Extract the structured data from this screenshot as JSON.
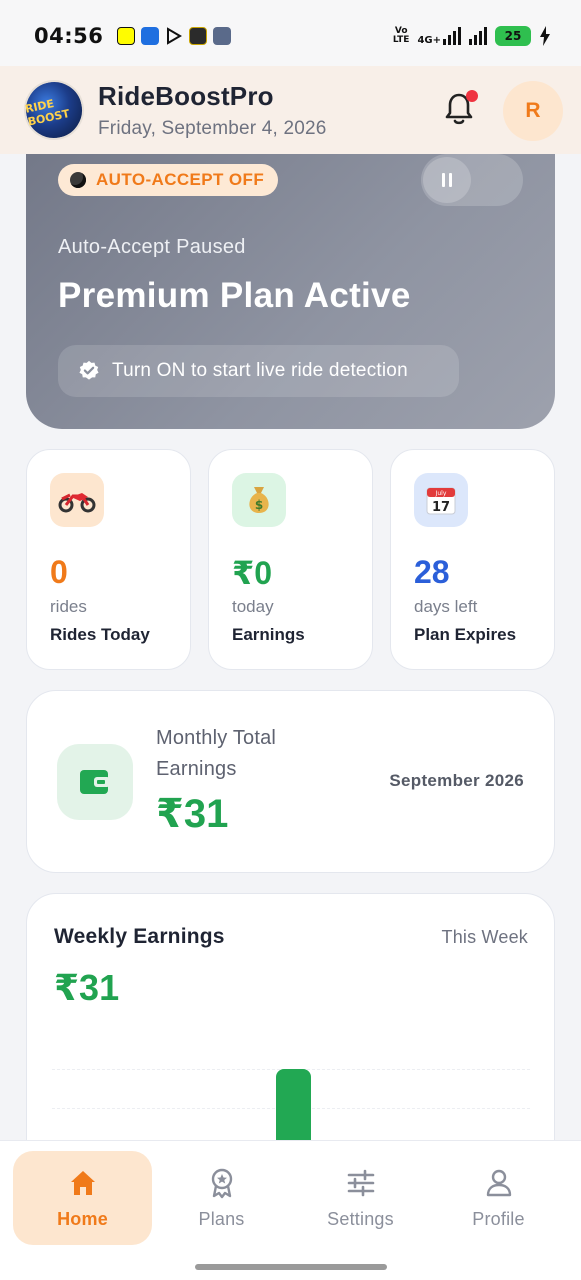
{
  "status_bar": {
    "time": "04:56",
    "network_label_1": "Vo",
    "network_label_2": "LTE",
    "network_type": "4G+",
    "battery": "25"
  },
  "header": {
    "title": "RideBoostPro",
    "date": "Friday, September 4, 2026",
    "user_initial": "R",
    "logo_text": "RIDE BOOST"
  },
  "hero": {
    "badge": "AUTO-ACCEPT OFF",
    "subtitle": "Auto-Accept Paused",
    "title": "Premium Plan Active",
    "hint": "Turn ON to start live ride detection",
    "toggle_state": "off",
    "toggle_icon": "pause-icon"
  },
  "stats": [
    {
      "icon": "motorcycle-icon",
      "value": "0",
      "unit": "rides",
      "label": "Rides Today",
      "color": "#f07a1a"
    },
    {
      "icon": "money-bag-icon",
      "value": "₹0",
      "unit": "today",
      "label": "Earnings",
      "color": "#21a350"
    },
    {
      "icon": "calendar-icon",
      "value": "28",
      "unit": "days left",
      "label": "Plan Expires",
      "color": "#2b5fd9",
      "calendar_month": "July",
      "calendar_day": "17"
    }
  ],
  "monthly": {
    "title": "Monthly Total Earnings",
    "amount": "₹31",
    "month": "September 2026"
  },
  "weekly": {
    "title": "Weekly Earnings",
    "period": "This Week",
    "amount": "₹31"
  },
  "chart_data": {
    "type": "bar",
    "title": "Weekly Earnings",
    "series": [
      {
        "values": [
          0,
          0,
          0,
          31,
          0,
          0,
          0
        ]
      }
    ],
    "bar_color": "#22a853"
  },
  "nav": {
    "items": [
      {
        "label": "Home",
        "icon": "home-icon",
        "active": true
      },
      {
        "label": "Plans",
        "icon": "plans-badge-icon",
        "active": false
      },
      {
        "label": "Settings",
        "icon": "sliders-icon",
        "active": false
      },
      {
        "label": "Profile",
        "icon": "person-icon",
        "active": false
      }
    ]
  },
  "colors": {
    "accent_orange": "#f07a1a",
    "accent_green": "#21a350",
    "accent_blue": "#2b5fd9"
  }
}
